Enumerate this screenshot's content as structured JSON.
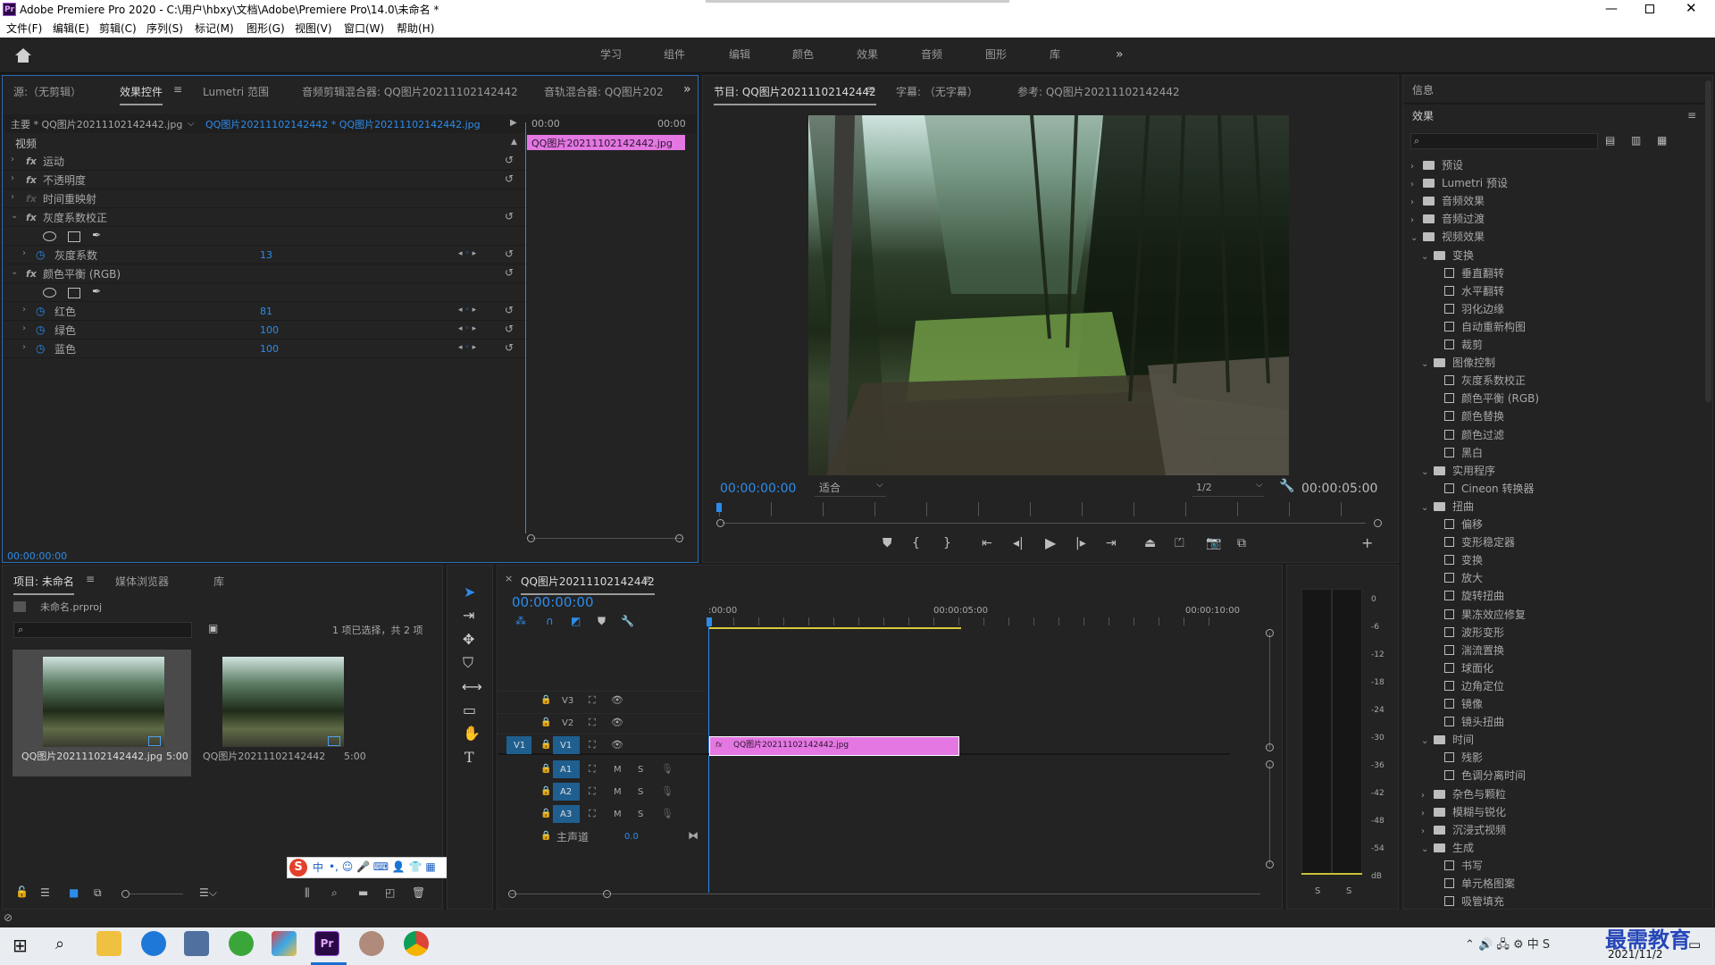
{
  "app": {
    "title": "Adobe Premiere Pro 2020 - C:\\用户\\hbxy\\文档\\Adobe\\Premiere Pro\\14.0\\未命名 *"
  },
  "menu": [
    "文件(F)",
    "编辑(E)",
    "剪辑(C)",
    "序列(S)",
    "标记(M)",
    "图形(G)",
    "视图(V)",
    "窗口(W)",
    "帮助(H)"
  ],
  "workspaces": [
    "学习",
    "组件",
    "编辑",
    "颜色",
    "效果",
    "音频",
    "图形",
    "库"
  ],
  "source_panel": {
    "tabs": [
      "源:（无剪辑）",
      "效果控件",
      "Lumetri 范围",
      "音频剪辑混合器: QQ图片20211102142442",
      "音轨混合器: QQ图片202"
    ],
    "master": "主要 * QQ图片20211102142442.jpg",
    "seq": "QQ图片20211102142442 * QQ图片20211102142442.jpg",
    "t_start": "00:00",
    "t_end": "00:00",
    "clip": "QQ图片20211102142442.jpg",
    "video_label": "视频",
    "effects": [
      {
        "name": "运动",
        "fx": true
      },
      {
        "name": "不透明度",
        "fx": true
      },
      {
        "name": "时间重映射",
        "fx": true
      },
      {
        "name": "灰度系数校正",
        "fx": true
      },
      {
        "name": "灰度系数",
        "value": "13"
      },
      {
        "name": "颜色平衡 (RGB)",
        "fx": true
      },
      {
        "name": "红色",
        "value": "81"
      },
      {
        "name": "绿色",
        "value": "100"
      },
      {
        "name": "蓝色",
        "value": "100"
      }
    ],
    "timecode": "00:00:00:00"
  },
  "program": {
    "tabs": [
      "节目: QQ图片20211102142442",
      "字幕: （无字幕）",
      "参考: QQ图片20211102142442"
    ],
    "timecode": "00:00:00:00",
    "fit": "适合",
    "res": "1/2",
    "duration": "00:00:05:00"
  },
  "effects_panel": {
    "info": "信息",
    "title": "效果",
    "tree": [
      {
        "label": "预设",
        "lvl": 0,
        "type": "folder"
      },
      {
        "label": "Lumetri 预设",
        "lvl": 0,
        "type": "folder"
      },
      {
        "label": "音频效果",
        "lvl": 0,
        "type": "folder"
      },
      {
        "label": "音频过渡",
        "lvl": 0,
        "type": "folder"
      },
      {
        "label": "视频效果",
        "lvl": 0,
        "type": "folder",
        "open": true
      },
      {
        "label": "变换",
        "lvl": 1,
        "type": "folder",
        "open": true
      },
      {
        "label": "垂直翻转",
        "lvl": 2,
        "type": "fx"
      },
      {
        "label": "水平翻转",
        "lvl": 2,
        "type": "fx"
      },
      {
        "label": "羽化边缘",
        "lvl": 2,
        "type": "fx"
      },
      {
        "label": "自动重新构图",
        "lvl": 2,
        "type": "fx"
      },
      {
        "label": "裁剪",
        "lvl": 2,
        "type": "fx"
      },
      {
        "label": "图像控制",
        "lvl": 1,
        "type": "folder",
        "open": true
      },
      {
        "label": "灰度系数校正",
        "lvl": 2,
        "type": "fx"
      },
      {
        "label": "颜色平衡 (RGB)",
        "lvl": 2,
        "type": "fx"
      },
      {
        "label": "颜色替换",
        "lvl": 2,
        "type": "fx"
      },
      {
        "label": "颜色过滤",
        "lvl": 2,
        "type": "fx"
      },
      {
        "label": "黑白",
        "lvl": 2,
        "type": "fx"
      },
      {
        "label": "实用程序",
        "lvl": 1,
        "type": "folder",
        "open": true
      },
      {
        "label": "Cineon 转换器",
        "lvl": 2,
        "type": "fx"
      },
      {
        "label": "扭曲",
        "lvl": 1,
        "type": "folder",
        "open": true
      },
      {
        "label": "偏移",
        "lvl": 2,
        "type": "fx"
      },
      {
        "label": "变形稳定器",
        "lvl": 2,
        "type": "fx"
      },
      {
        "label": "变换",
        "lvl": 2,
        "type": "fx"
      },
      {
        "label": "放大",
        "lvl": 2,
        "type": "fx"
      },
      {
        "label": "旋转扭曲",
        "lvl": 2,
        "type": "fx"
      },
      {
        "label": "果冻效应修复",
        "lvl": 2,
        "type": "fx"
      },
      {
        "label": "波形变形",
        "lvl": 2,
        "type": "fx"
      },
      {
        "label": "湍流置换",
        "lvl": 2,
        "type": "fx"
      },
      {
        "label": "球面化",
        "lvl": 2,
        "type": "fx"
      },
      {
        "label": "边角定位",
        "lvl": 2,
        "type": "fx"
      },
      {
        "label": "镜像",
        "lvl": 2,
        "type": "fx"
      },
      {
        "label": "镜头扭曲",
        "lvl": 2,
        "type": "fx"
      },
      {
        "label": "时间",
        "lvl": 1,
        "type": "folder",
        "open": true
      },
      {
        "label": "残影",
        "lvl": 2,
        "type": "fx"
      },
      {
        "label": "色调分离时间",
        "lvl": 2,
        "type": "fx"
      },
      {
        "label": "杂色与颗粒",
        "lvl": 1,
        "type": "folder"
      },
      {
        "label": "模糊与锐化",
        "lvl": 1,
        "type": "folder"
      },
      {
        "label": "沉浸式视频",
        "lvl": 1,
        "type": "folder"
      },
      {
        "label": "生成",
        "lvl": 1,
        "type": "folder",
        "open": true
      },
      {
        "label": "书写",
        "lvl": 2,
        "type": "fx"
      },
      {
        "label": "单元格图案",
        "lvl": 2,
        "type": "fx"
      },
      {
        "label": "吸管填充",
        "lvl": 2,
        "type": "fx"
      }
    ]
  },
  "project": {
    "tabs": [
      "项目: 未命名",
      "媒体浏览器",
      "库"
    ],
    "file": "未命名.prproj",
    "status": "1 项已选择，共 2 项",
    "items": [
      {
        "name": "QQ图片20211102142442.jpg",
        "dur": "5:00"
      },
      {
        "name": "QQ图片20211102142442",
        "dur": "5:00"
      }
    ]
  },
  "timeline": {
    "tab": "QQ图片20211102142442",
    "timecode": "00:00:00:00",
    "ruler": [
      ":00:00",
      "00:00:05:00",
      "00:00:10:00"
    ],
    "tracks": [
      "V3",
      "V2",
      "V1",
      "A1",
      "A2",
      "A3"
    ],
    "src_v": "V1",
    "master": "主声道",
    "master_val": "0.0",
    "clip": "QQ图片20211102142442.jpg",
    "m": "M",
    "s": "S"
  },
  "meter": {
    "labels": [
      "0",
      "-6",
      "-12",
      "-18",
      "-24",
      "-30",
      "-36",
      "-42",
      "-48",
      "-54",
      "dB"
    ],
    "s": "S"
  },
  "ime": {
    "mode": "中"
  },
  "taskbar": {
    "date": "2021/11/2",
    "watermark": "最需教育"
  }
}
